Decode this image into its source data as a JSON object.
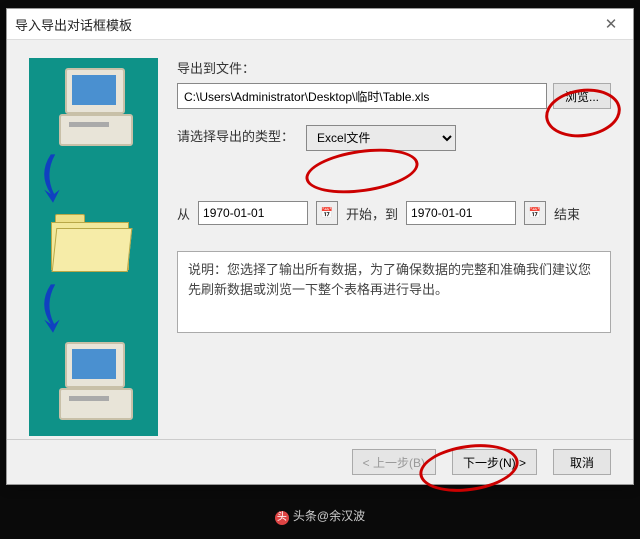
{
  "dialog": {
    "title": "导入导出对话框模板",
    "close": "✕"
  },
  "export": {
    "label": "导出到文件：",
    "path": "C:\\Users\\Administrator\\Desktop\\临时\\Table.xls",
    "browse": "浏览..."
  },
  "type": {
    "label": "请选择导出的类型：",
    "value": "Excel文件"
  },
  "range": {
    "from_lbl": "从",
    "from": "1970-01-01",
    "mid": "开始，到",
    "to": "1970-01-01",
    "end_lbl": "结束"
  },
  "desc": "说明：您选择了输出所有数据，为了确保数据的完整和准确我们建议您先刷新数据或浏览一下整个表格再进行导出。",
  "footer": {
    "back": "< 上一步(B)",
    "next": "下一步(N) >",
    "cancel": "取消"
  },
  "watermark": "头条@余汉波"
}
